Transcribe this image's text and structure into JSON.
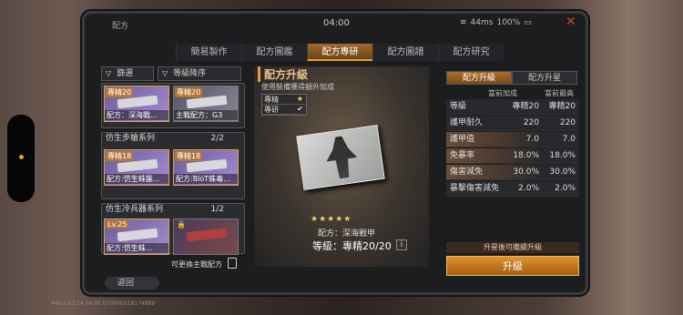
{
  "status": {
    "title": "配方",
    "time": "04:00",
    "network": "44ms",
    "battery": "100%"
  },
  "tabs": [
    "簡易製作",
    "配方圖鑑",
    "配方專研",
    "配方圖譜",
    "配方研究"
  ],
  "active_tab": 2,
  "left": {
    "filter_label": "篩選",
    "sort_label": "等級降序",
    "group1": {
      "cards": [
        {
          "badge": "專精20",
          "label": "配方：深海戰..."
        },
        {
          "badge": "專精20",
          "label": "主戰配方：G3"
        }
      ]
    },
    "group2": {
      "title": "仿生步槍系列",
      "count": "2/2",
      "cards": [
        {
          "badge": "專精18",
          "label": "配方:仿生蛛盤..."
        },
        {
          "badge": "專精18",
          "label": "配方:BioT蛛毒..."
        }
      ]
    },
    "group3": {
      "title": "仿生冷兵器系列",
      "count": "1/2",
      "cards": [
        {
          "badge": "Lv.25",
          "label": "配方:仿生蛛..."
        },
        {
          "badge": "",
          "label": ""
        }
      ]
    },
    "switch_text": "可更換主戰配方",
    "back_label": "返回"
  },
  "center": {
    "title": "配方升級",
    "subtitle": "使用裝備獲得額外加成",
    "checklist": [
      {
        "label": "專精",
        "mark": "★"
      },
      {
        "label": "專研",
        "mark": "✔"
      }
    ],
    "stars": "★★★★★",
    "name": "配方：深海戰甲",
    "level": "等級：專精20/20",
    "info": "i"
  },
  "right": {
    "tabs": [
      "配方升級",
      "配方升星"
    ],
    "col_current": "當前加成",
    "col_max": "當前最高",
    "rows": [
      {
        "name": "等級",
        "cur": "專精20",
        "max": "專精20"
      },
      {
        "name": "護甲耐久",
        "cur": "220",
        "max": "220"
      },
      {
        "name": "護甲值",
        "cur": "7.0",
        "max": "7.0"
      },
      {
        "name": "免暴率",
        "cur": "18.0%",
        "max": "18.0%"
      },
      {
        "name": "傷害減免",
        "cur": "30.0%",
        "max": "30.0%"
      },
      {
        "name": "暴擊傷害減免",
        "cur": "2.0%",
        "max": "2.0%"
      }
    ],
    "hint": "升星後可繼續升級",
    "upgrade_label": "升級"
  },
  "footer": "44ms 03:14 04:00 b70000318174889"
}
